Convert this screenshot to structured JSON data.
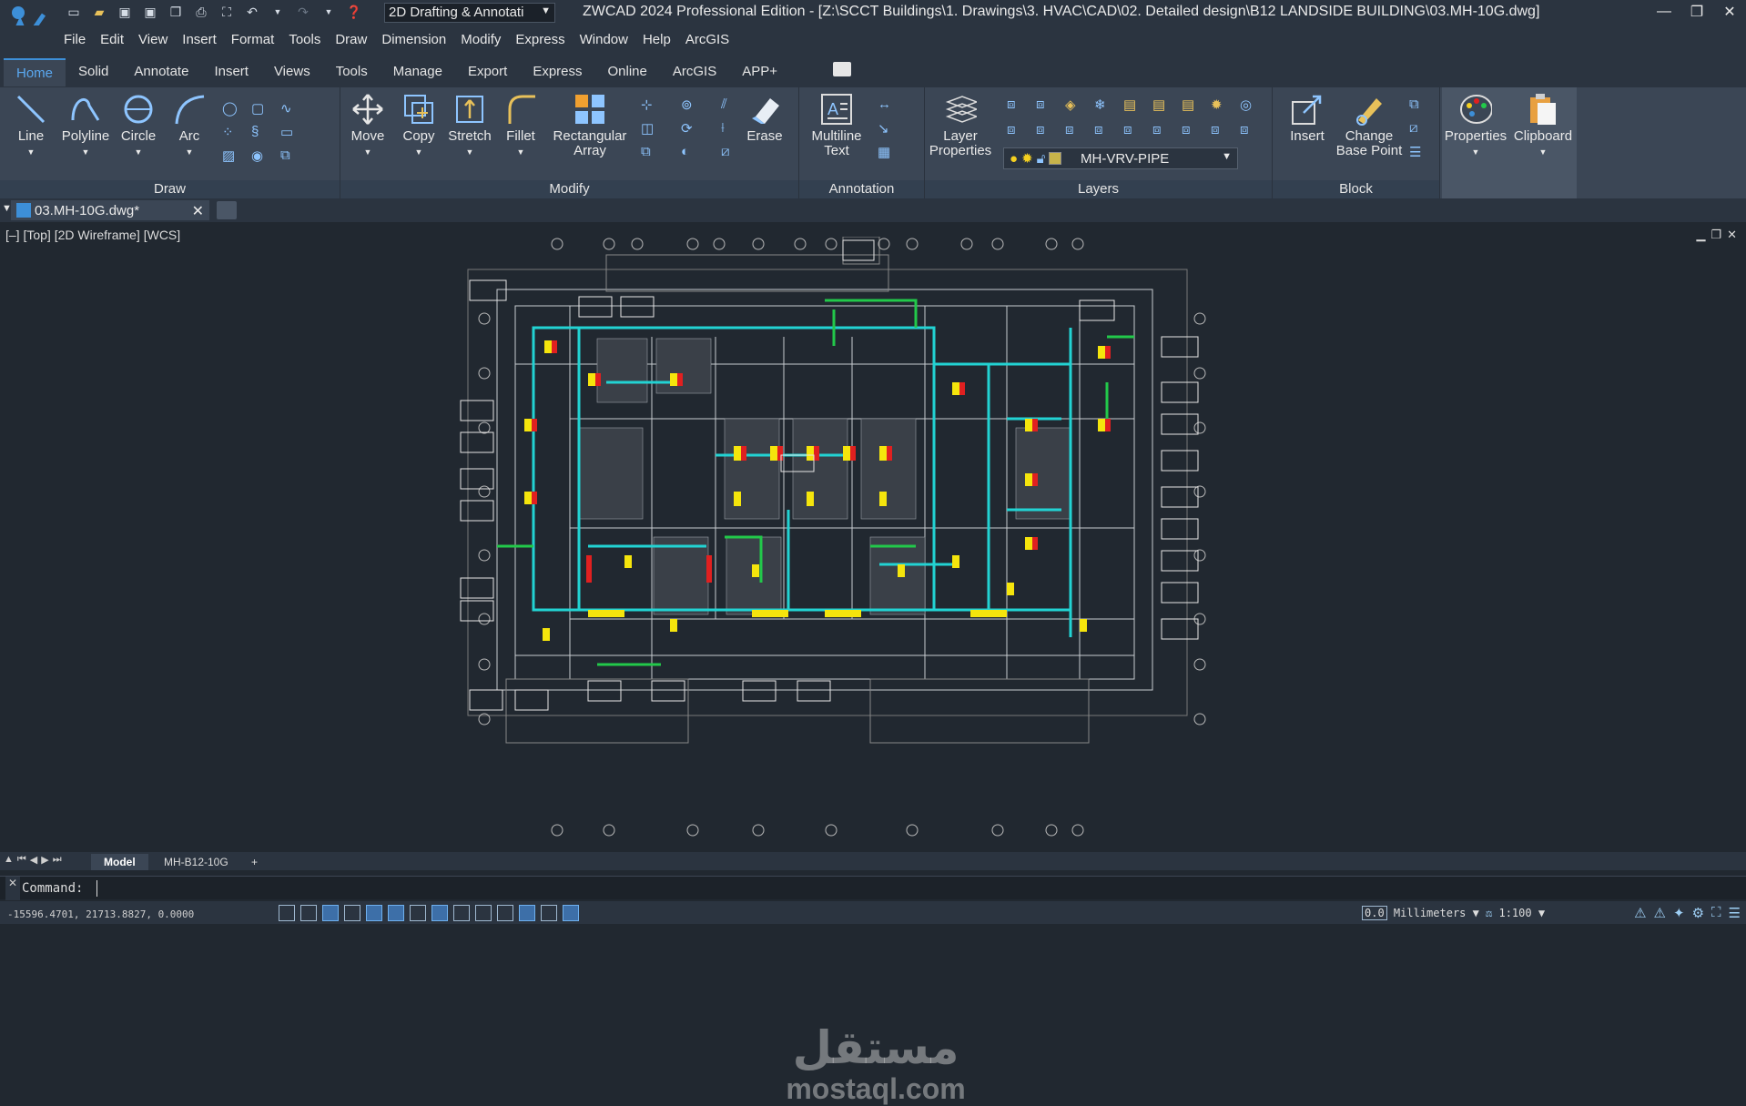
{
  "app": {
    "workspace": "2D Drafting & Annotati",
    "window_title": "ZWCAD 2024 Professional Edition - [Z:\\SCCT Buildings\\1. Drawings\\3. HVAC\\CAD\\02. Detailed design\\B12 LANDSIDE BUILDING\\03.MH-10G.dwg]"
  },
  "menu": [
    "File",
    "Edit",
    "View",
    "Insert",
    "Format",
    "Tools",
    "Draw",
    "Dimension",
    "Modify",
    "Express",
    "Window",
    "Help",
    "ArcGIS"
  ],
  "ribbon_tabs": [
    "Home",
    "Solid",
    "Annotate",
    "Insert",
    "Views",
    "Tools",
    "Manage",
    "Export",
    "Express",
    "Online",
    "ArcGIS",
    "APP+"
  ],
  "active_tab": "Home",
  "panels": {
    "draw": {
      "title": "Draw",
      "buttons": [
        "Line",
        "Polyline",
        "Circle",
        "Arc"
      ]
    },
    "modify": {
      "title": "Modify",
      "buttons": [
        "Move",
        "Copy",
        "Stretch",
        "Fillet",
        "Rectangular\nArray",
        "Erase"
      ]
    },
    "annotation": {
      "title": "Annotation",
      "buttons": [
        "Multiline\nText"
      ]
    },
    "layers": {
      "title": "Layers",
      "buttons": [
        "Layer\nProperties"
      ],
      "current_layer": "MH-VRV-PIPE"
    },
    "block": {
      "title": "Block",
      "buttons": [
        "Insert",
        "Change\nBase Point"
      ]
    },
    "properties": {
      "label": "Properties"
    },
    "clipboard": {
      "label": "Clipboard"
    }
  },
  "document_tab": "03.MH-10G.dwg*",
  "viewport_label": "[–] [Top] [2D Wireframe] [WCS]",
  "layout_tabs": [
    "Model",
    "MH-B12-10G",
    "+"
  ],
  "active_layout": "Model",
  "command": {
    "label": "Command:"
  },
  "status": {
    "coordinates": "-15596.4701, 21713.8827, 0.0000",
    "precision": "0.0",
    "units": "Millimeters",
    "scale": "1:100"
  },
  "watermark": {
    "arabic": "مستقل",
    "latin": "mostaql.com"
  },
  "colors": {
    "background": "#212830",
    "ribbon": "#3b4655",
    "accent": "#5aa8f0",
    "duct_cyan": "#22d3d3",
    "duct_green": "#22c94a",
    "equipment_yellow": "#f5e50c",
    "equipment_red": "#e02020"
  }
}
